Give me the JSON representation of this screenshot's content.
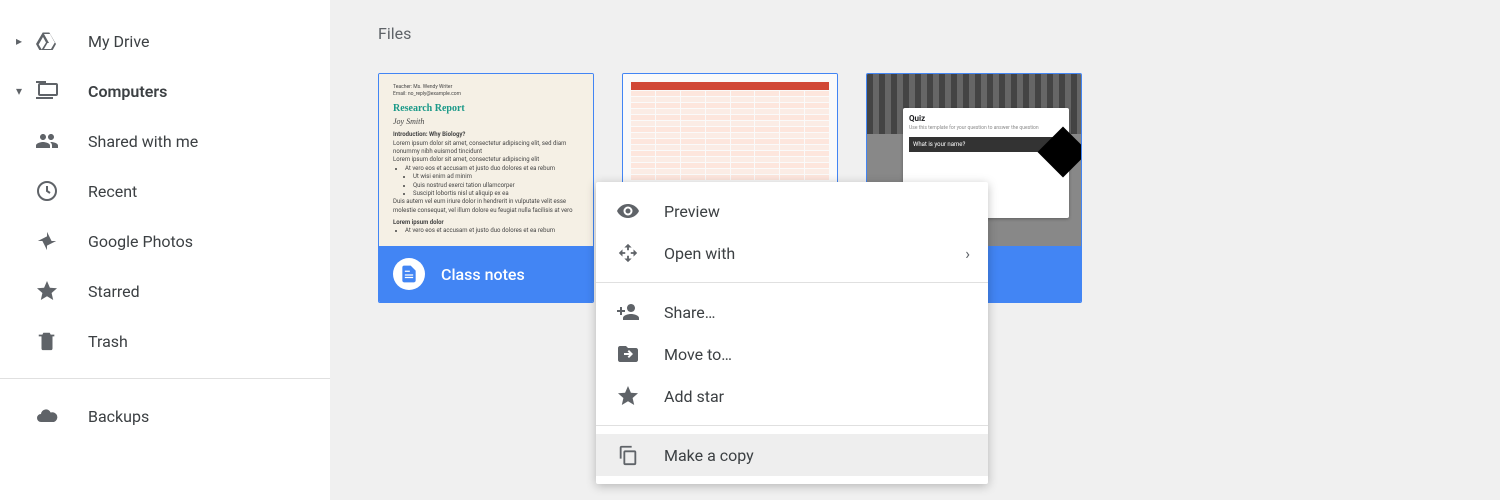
{
  "sidebar": {
    "items": [
      {
        "label": "My Drive",
        "expanded": false
      },
      {
        "label": "Computers",
        "expanded": true,
        "active": true
      },
      {
        "label": "Shared with me"
      },
      {
        "label": "Recent"
      },
      {
        "label": "Google Photos"
      },
      {
        "label": "Starred"
      },
      {
        "label": "Trash"
      }
    ],
    "backups_label": "Backups"
  },
  "main": {
    "section_title": "Files",
    "files": [
      {
        "name": "Class notes",
        "type": "docs"
      },
      {
        "name": "",
        "type": "sheets"
      },
      {
        "name": "Quiz",
        "type": "forms"
      }
    ]
  },
  "context_menu": {
    "preview": "Preview",
    "open_with": "Open with",
    "share": "Share…",
    "move_to": "Move to…",
    "add_star": "Add star",
    "make_copy": "Make a copy"
  },
  "doc_preview": {
    "teacher_line": "Teacher: Ms. Wendy Writer",
    "email_line": "Email: no_reply@example.com",
    "title": "Research Report",
    "author": "Joy Smith",
    "intro_heading": "Introduction: Why Biology?"
  },
  "form_preview": {
    "title": "Quiz",
    "question": "What is your name?"
  }
}
